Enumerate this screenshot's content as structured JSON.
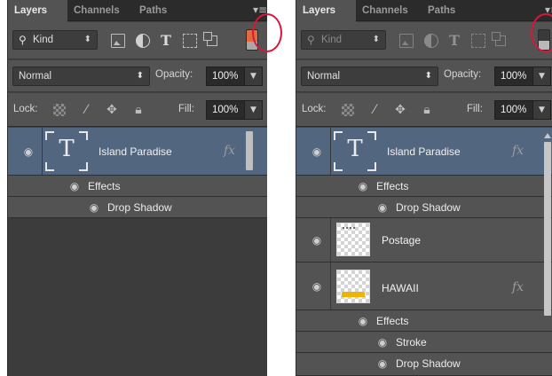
{
  "tabs": [
    "Layers",
    "Channels",
    "Paths"
  ],
  "filter": {
    "kind_label": "Kind"
  },
  "blend": {
    "mode": "Normal",
    "opacity_label": "Opacity:",
    "opacity_value": "100%"
  },
  "lock": {
    "label": "Lock:",
    "fill_label": "Fill:",
    "fill_value": "100%"
  },
  "fx_label": "fx",
  "left_panel": {
    "layers": [
      {
        "name": "Island Paradise",
        "effects_label": "Effects",
        "effects": [
          "Drop Shadow"
        ]
      }
    ]
  },
  "right_panel": {
    "layers": [
      {
        "name": "Island Paradise",
        "effects_label": "Effects",
        "effects": [
          "Drop Shadow"
        ]
      },
      {
        "name": "Postage"
      },
      {
        "name": "HAWAII",
        "effects_label": "Effects",
        "effects": [
          "Stroke",
          "Drop Shadow"
        ]
      }
    ]
  },
  "highlight_color": "#d9163b",
  "filter_toggle": {
    "left_state": "on",
    "right_state": "off"
  },
  "icons": [
    "search-icon",
    "pixel-filter-icon",
    "adjustment-filter-icon",
    "type-filter-icon",
    "shape-filter-icon",
    "smart-object-filter-icon",
    "filter-toggle-icon",
    "panel-menu-icon",
    "eye-icon",
    "lock-transparent-icon",
    "lock-brush-icon",
    "lock-move-icon",
    "lock-all-icon"
  ]
}
